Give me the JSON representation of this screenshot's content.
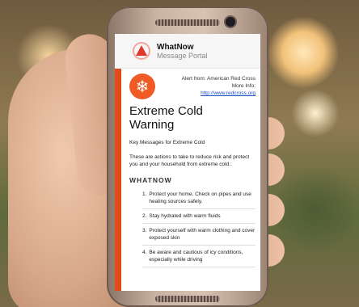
{
  "app": {
    "name": "WhatNow",
    "subtitle": "Message Portal"
  },
  "alert": {
    "from_label": "Alert from: American Red Cross",
    "more_info_label": "More Info:",
    "link": "http://www.redcross.org",
    "icon": "snowflake-icon",
    "title_line1": "Extreme Cold",
    "title_line2": "Warning",
    "key_messages": "Key Messages for Extreme Cold",
    "intro": "These are actions to take to reduce risk and protect you and your household from extreme cold.:",
    "section_heading": "WHATNOW"
  },
  "actions": [
    {
      "num": "1.",
      "text": "Protect your home. Check on pipes and use heating sources safely."
    },
    {
      "num": "2.",
      "text": "Stay hydrated with warm fluids"
    },
    {
      "num": "3.",
      "text": "Protect yourself with warm clothing and cover exposed skin"
    },
    {
      "num": "4.",
      "text": "Be aware and cautious of icy conditions, especially while driving"
    }
  ],
  "colors": {
    "accent": "#e24a1c",
    "icon_bg": "#f05a23",
    "link": "#1a4fc4",
    "logo": "#e2372b"
  }
}
